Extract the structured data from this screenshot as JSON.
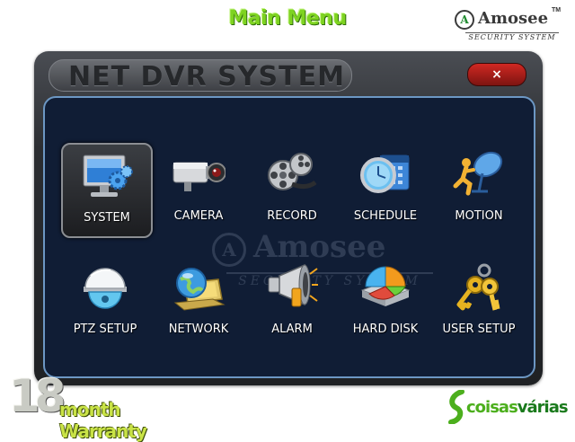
{
  "page_heading": "Main Menu",
  "brand": {
    "mark": "A",
    "name": "Amosee",
    "trademark": "TM",
    "tagline": "SECURITY SYSTEM"
  },
  "window": {
    "title": "NET DVR SYSTEM",
    "close_label": "×",
    "watermark": {
      "mark": "A",
      "name": "Amosee",
      "tagline": "SECURITY SYSTEM"
    }
  },
  "menu": {
    "selected": "SYSTEM",
    "items": [
      {
        "label": "SYSTEM",
        "icon": "monitor-gears-icon"
      },
      {
        "label": "CAMERA",
        "icon": "camera-icon"
      },
      {
        "label": "RECORD",
        "icon": "film-reel-icon"
      },
      {
        "label": "SCHEDULE",
        "icon": "clock-calendar-icon"
      },
      {
        "label": "MOTION",
        "icon": "running-person-icon"
      },
      {
        "label": "PTZ SETUP",
        "icon": "dome-camera-icon"
      },
      {
        "label": "NETWORK",
        "icon": "globe-laptop-icon"
      },
      {
        "label": "ALARM",
        "icon": "megaphone-icon"
      },
      {
        "label": "HARD DISK",
        "icon": "hard-disk-chart-icon"
      },
      {
        "label": "USER SETUP",
        "icon": "keys-icon"
      }
    ]
  },
  "warranty": {
    "number": "18",
    "text": "month Warranty"
  },
  "site_logo": {
    "part_a": "coisas",
    "part_b": "várias"
  },
  "colors": {
    "heading_green": "#7ed321",
    "panel_navy": "#101d35",
    "panel_border": "#6c97c4",
    "close_red": "#c0201c"
  }
}
